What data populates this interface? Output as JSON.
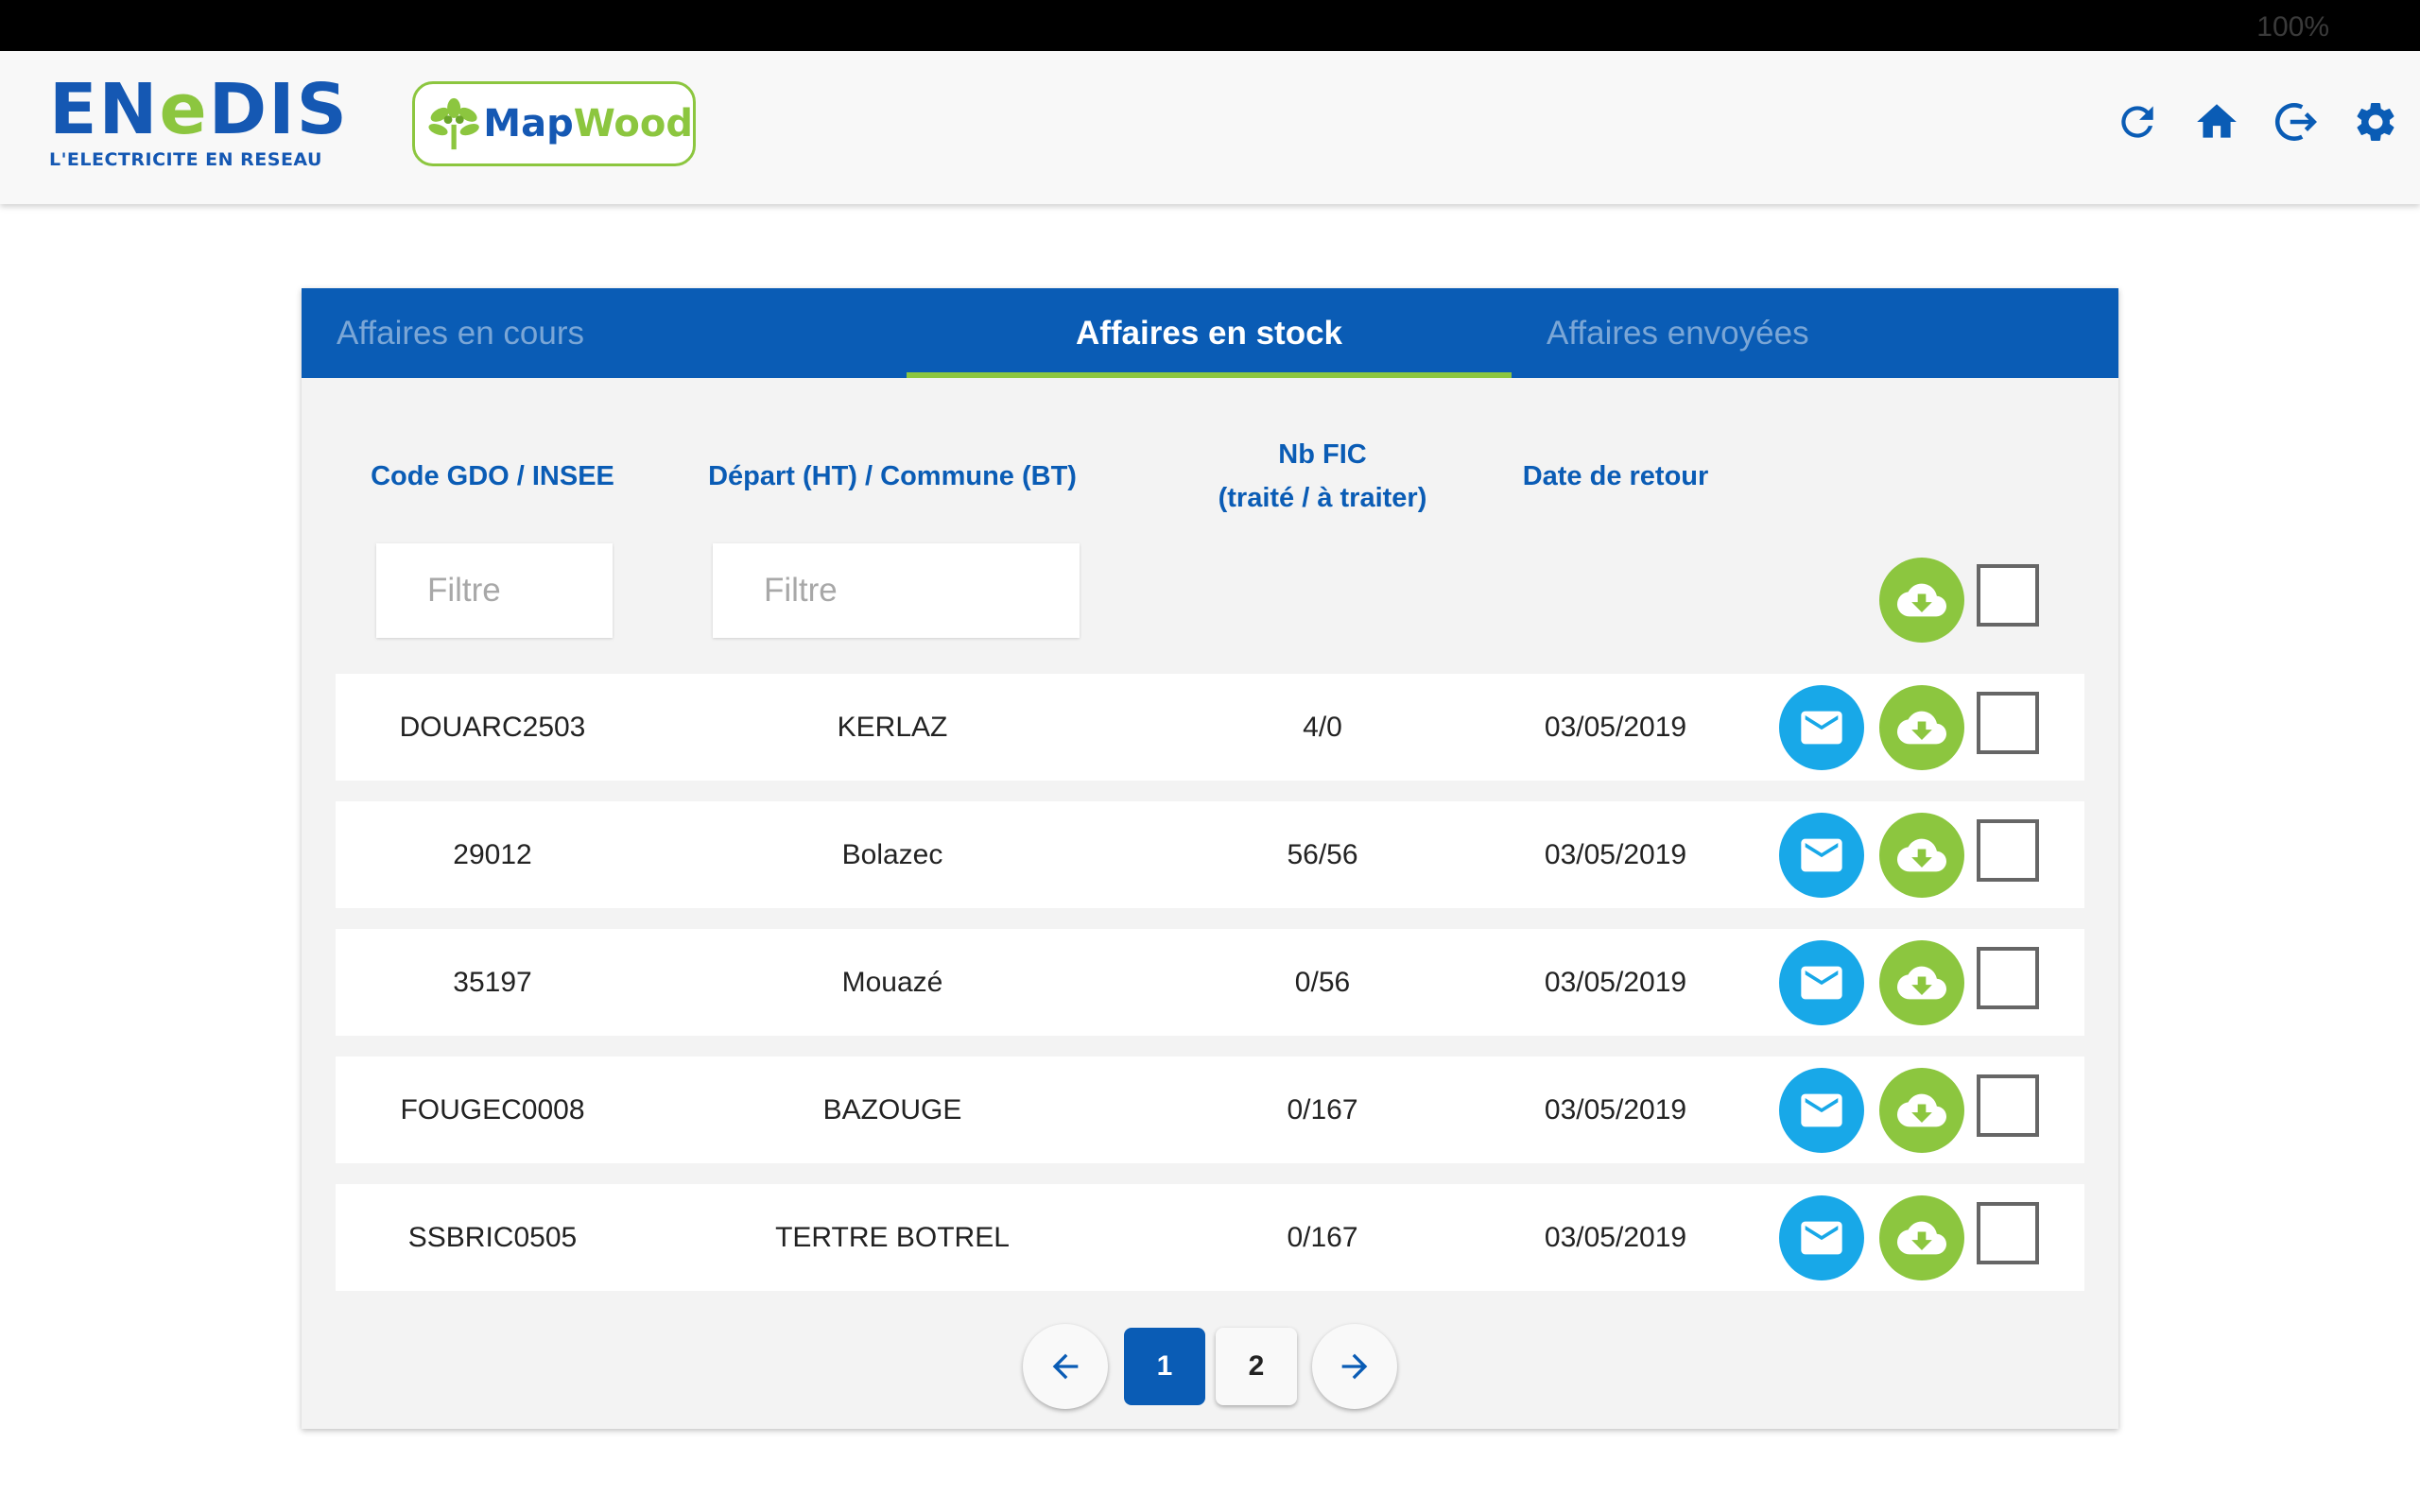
{
  "statusbar": {
    "battery_label": "100%"
  },
  "header": {
    "logo_main_a": "EN",
    "logo_main_b": "e",
    "logo_main_c": "DIS",
    "logo_tagline": "L'ELECTRICITE EN RESEAU",
    "app_name_a": "Map",
    "app_name_b": "Wood",
    "icons": [
      "refresh-icon",
      "home-icon",
      "logout-icon",
      "settings-icon"
    ]
  },
  "tabs": [
    {
      "label": "Affaires en cours",
      "active": false
    },
    {
      "label": "Affaires en stock",
      "active": true
    },
    {
      "label": "Affaires envoyées",
      "active": false
    }
  ],
  "columns": {
    "code": "Code GDO / INSEE",
    "depart": "Départ (HT) / Commune (BT)",
    "nbfic_line1": "Nb FIC",
    "nbfic_line2": "(traité / à traiter)",
    "date": "Date de retour"
  },
  "filters": {
    "code_placeholder": "Filtre",
    "depart_placeholder": "Filtre"
  },
  "rows": [
    {
      "code": "DOUARC2503",
      "depart": "KERLAZ",
      "nbfic": "4/0",
      "date": "03/05/2019"
    },
    {
      "code": "29012",
      "depart": "Bolazec",
      "nbfic": "56/56",
      "date": "03/05/2019"
    },
    {
      "code": "35197",
      "depart": "Mouazé",
      "nbfic": "0/56",
      "date": "03/05/2019"
    },
    {
      "code": "FOUGEC0008",
      "depart": "BAZOUGE",
      "nbfic": "0/167",
      "date": "03/05/2019"
    },
    {
      "code": "SSBRIC0505",
      "depart": "TERTRE BOTREL",
      "nbfic": "0/167",
      "date": "03/05/2019"
    }
  ],
  "pagination": {
    "pages": [
      "1",
      "2"
    ],
    "current": "1"
  },
  "colors": {
    "blue": "#0a5cb5",
    "green": "#8cc63f",
    "light_blue": "#18a8e8"
  }
}
